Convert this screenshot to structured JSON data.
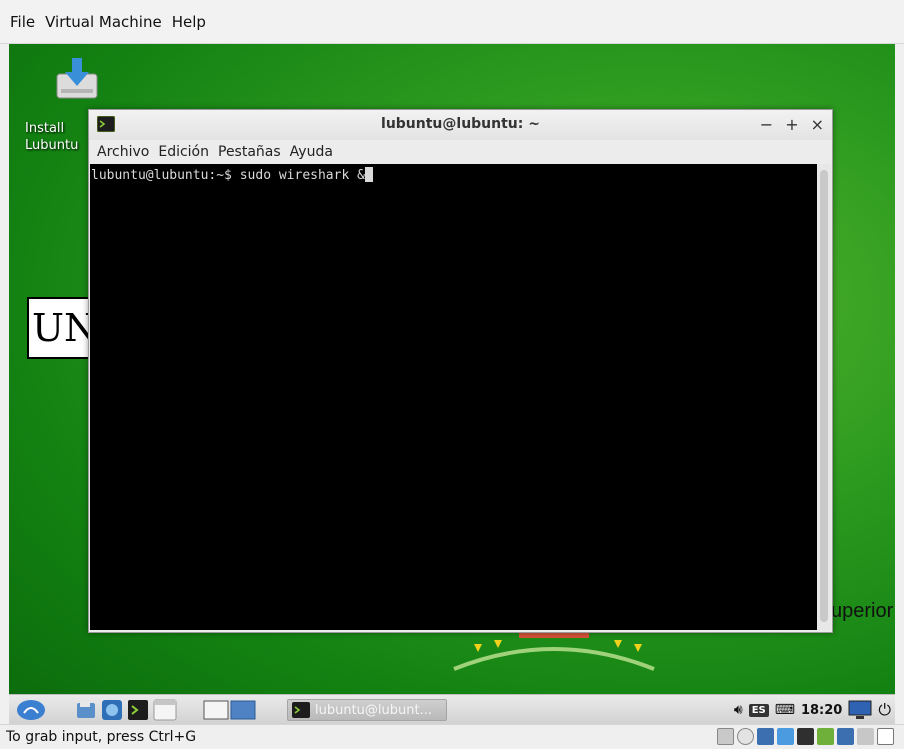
{
  "host": {
    "menu": [
      "File",
      "Virtual Machine",
      "Help"
    ],
    "status_text": "To grab input, press Ctrl+G"
  },
  "desktop": {
    "icon_label": "Install Lubuntu",
    "wallpaper_banner": "UN",
    "wallpaper_text": "uperior"
  },
  "terminal": {
    "title": "lubuntu@lubuntu: ~",
    "controls": [
      "−",
      "+",
      "×"
    ],
    "menu": [
      "Archivo",
      "Edición",
      "Pestañas",
      "Ayuda"
    ],
    "prompt": "lubuntu@lubuntu:~$ ",
    "command": "sudo wireshark &"
  },
  "taskbar": {
    "task_label": "lubuntu@lubunt...",
    "language": "ES",
    "clock": "18:20"
  },
  "colors": {
    "desktop_green": "#138212",
    "terminal_bg": "#000000",
    "terminal_fg": "#d9d9d9"
  }
}
